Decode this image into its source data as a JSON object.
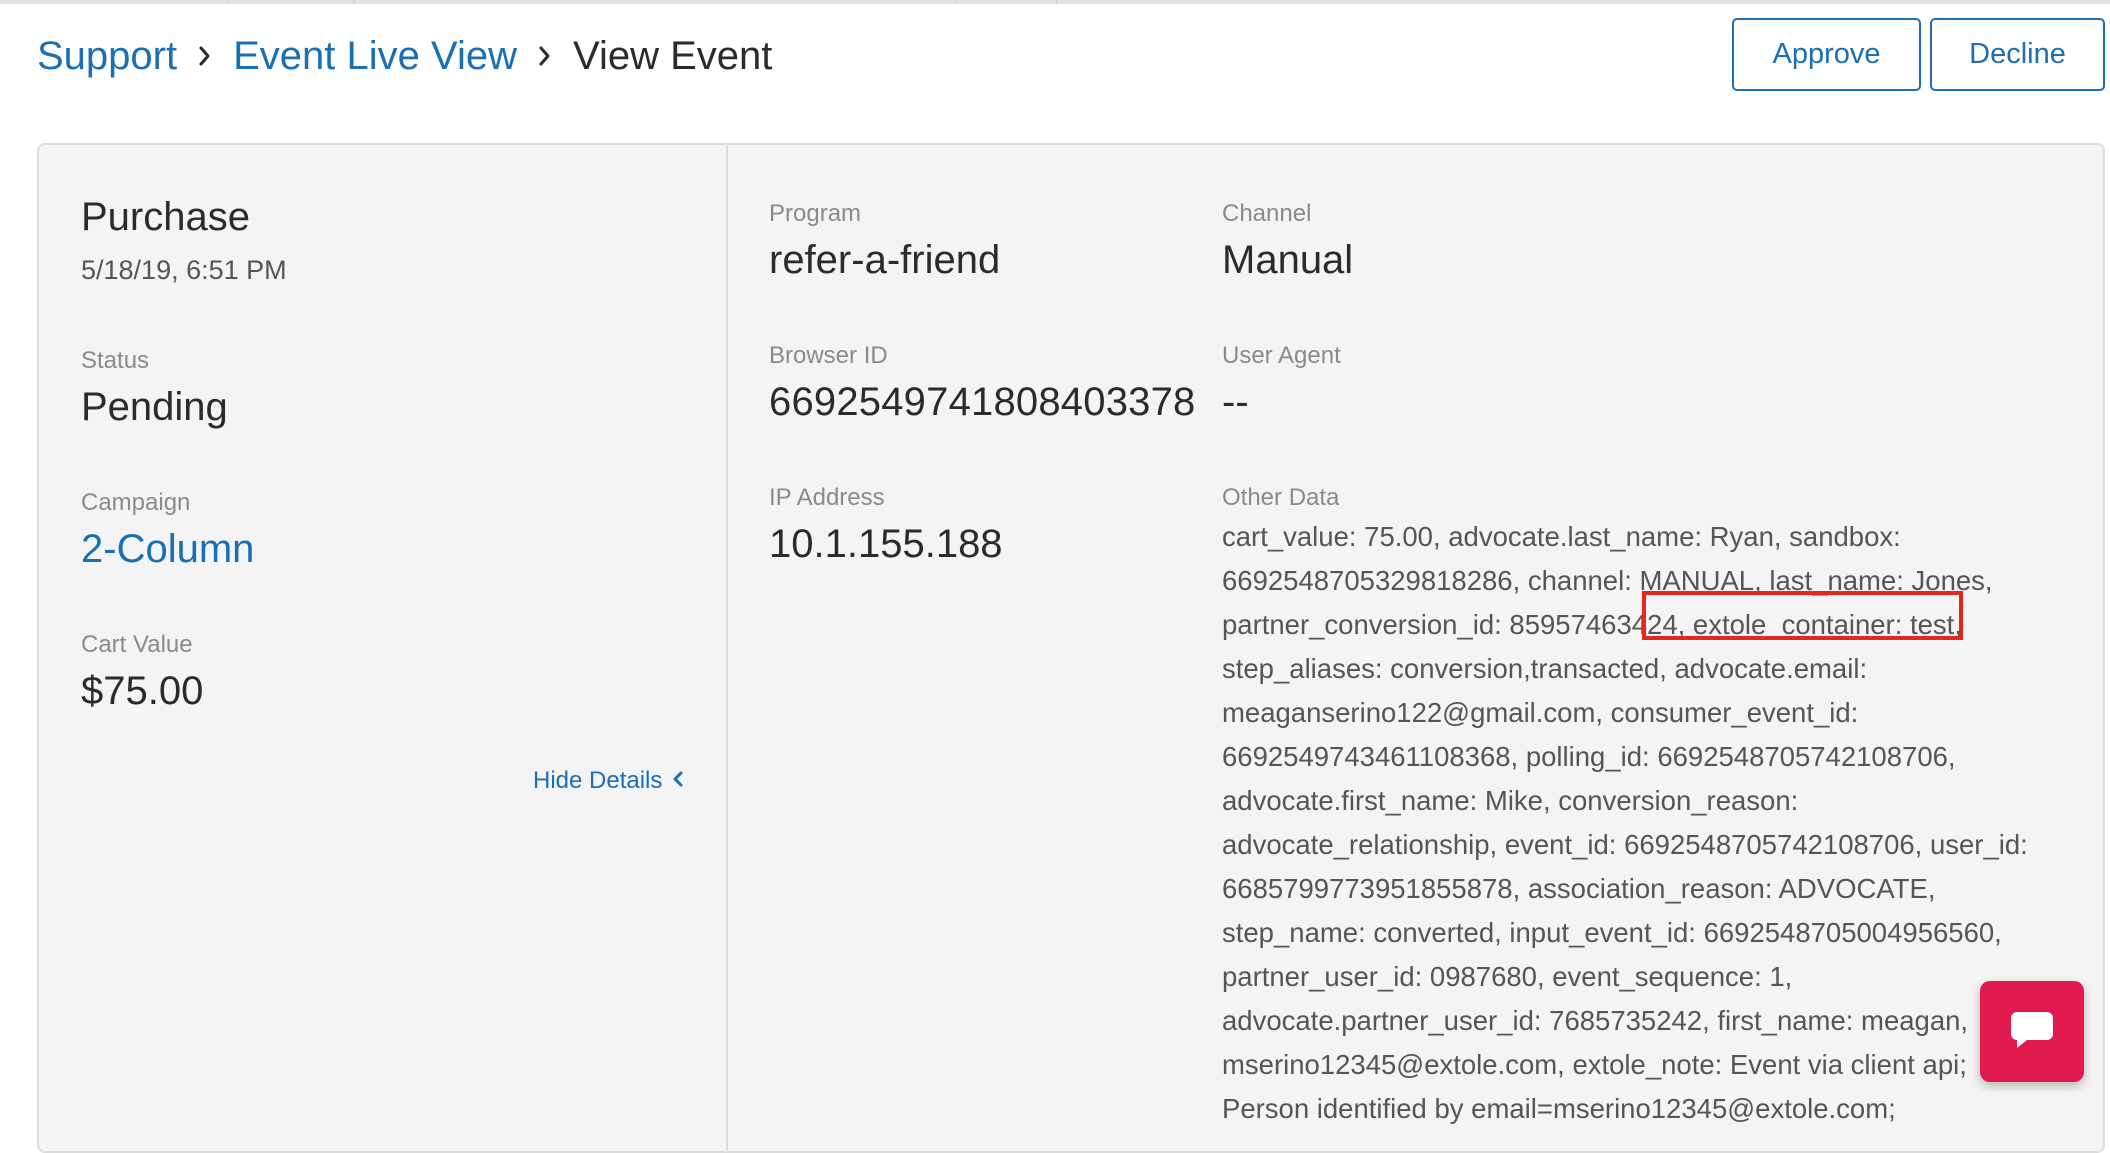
{
  "breadcrumb": {
    "items": [
      "Support",
      "Event Live View"
    ],
    "current": "View Event"
  },
  "actions": {
    "approve_label": "Approve",
    "decline_label": "Decline"
  },
  "event": {
    "type": "Purchase",
    "date": "5/18/19, 6:51 PM",
    "status_label": "Status",
    "status": "Pending",
    "campaign_label": "Campaign",
    "campaign": "2-Column",
    "cart_value_label": "Cart Value",
    "cart_value": "$75.00",
    "hide_details_label": "Hide Details"
  },
  "details": {
    "program_label": "Program",
    "program": "refer-a-friend",
    "channel_label": "Channel",
    "channel": "Manual",
    "browser_id_label": "Browser ID",
    "browser_id": "6692549741808403378",
    "user_agent_label": "User Agent",
    "user_agent": "--",
    "ip_label": "IP Address",
    "ip": "10.1.155.188",
    "other_data_label": "Other Data",
    "other_data_lines": [
      "cart_value: 75.00, advocate.last_name: Ryan, sandbox:",
      "6692548705329818286, channel: MANUAL, last_name: Jones,",
      "partner_conversion_id: 85957463424, extole_container: test,",
      "step_aliases: conversion,transacted, advocate.email:",
      "meaganserino122@gmail.com, consumer_event_id:",
      "6692549743461108368, polling_id: 6692548705742108706,",
      "advocate.first_name: Mike, conversion_reason:",
      "advocate_relationship, event_id: 6692548705742108706, user_id:",
      "6685799773951855878, association_reason: ADVOCATE,",
      "step_name: converted, input_event_id: 6692548705004956560,",
      "partner_user_id: 0987680, event_sequence: 1,",
      "advocate.partner_user_id: 7685735242, first_name: meagan,",
      "mserino12345@extole.com, extole_note: Event via client api;",
      "Person identified by email=mserino12345@extole.com;"
    ]
  },
  "icons": {
    "breadcrumb_separator": "chevron-right-icon",
    "hide_details": "chevron-left-icon",
    "chat": "chat-bubble-icon"
  },
  "colors": {
    "link": "#1a6fb5",
    "highlight": "#e5281f",
    "chat": "#e0194f"
  }
}
